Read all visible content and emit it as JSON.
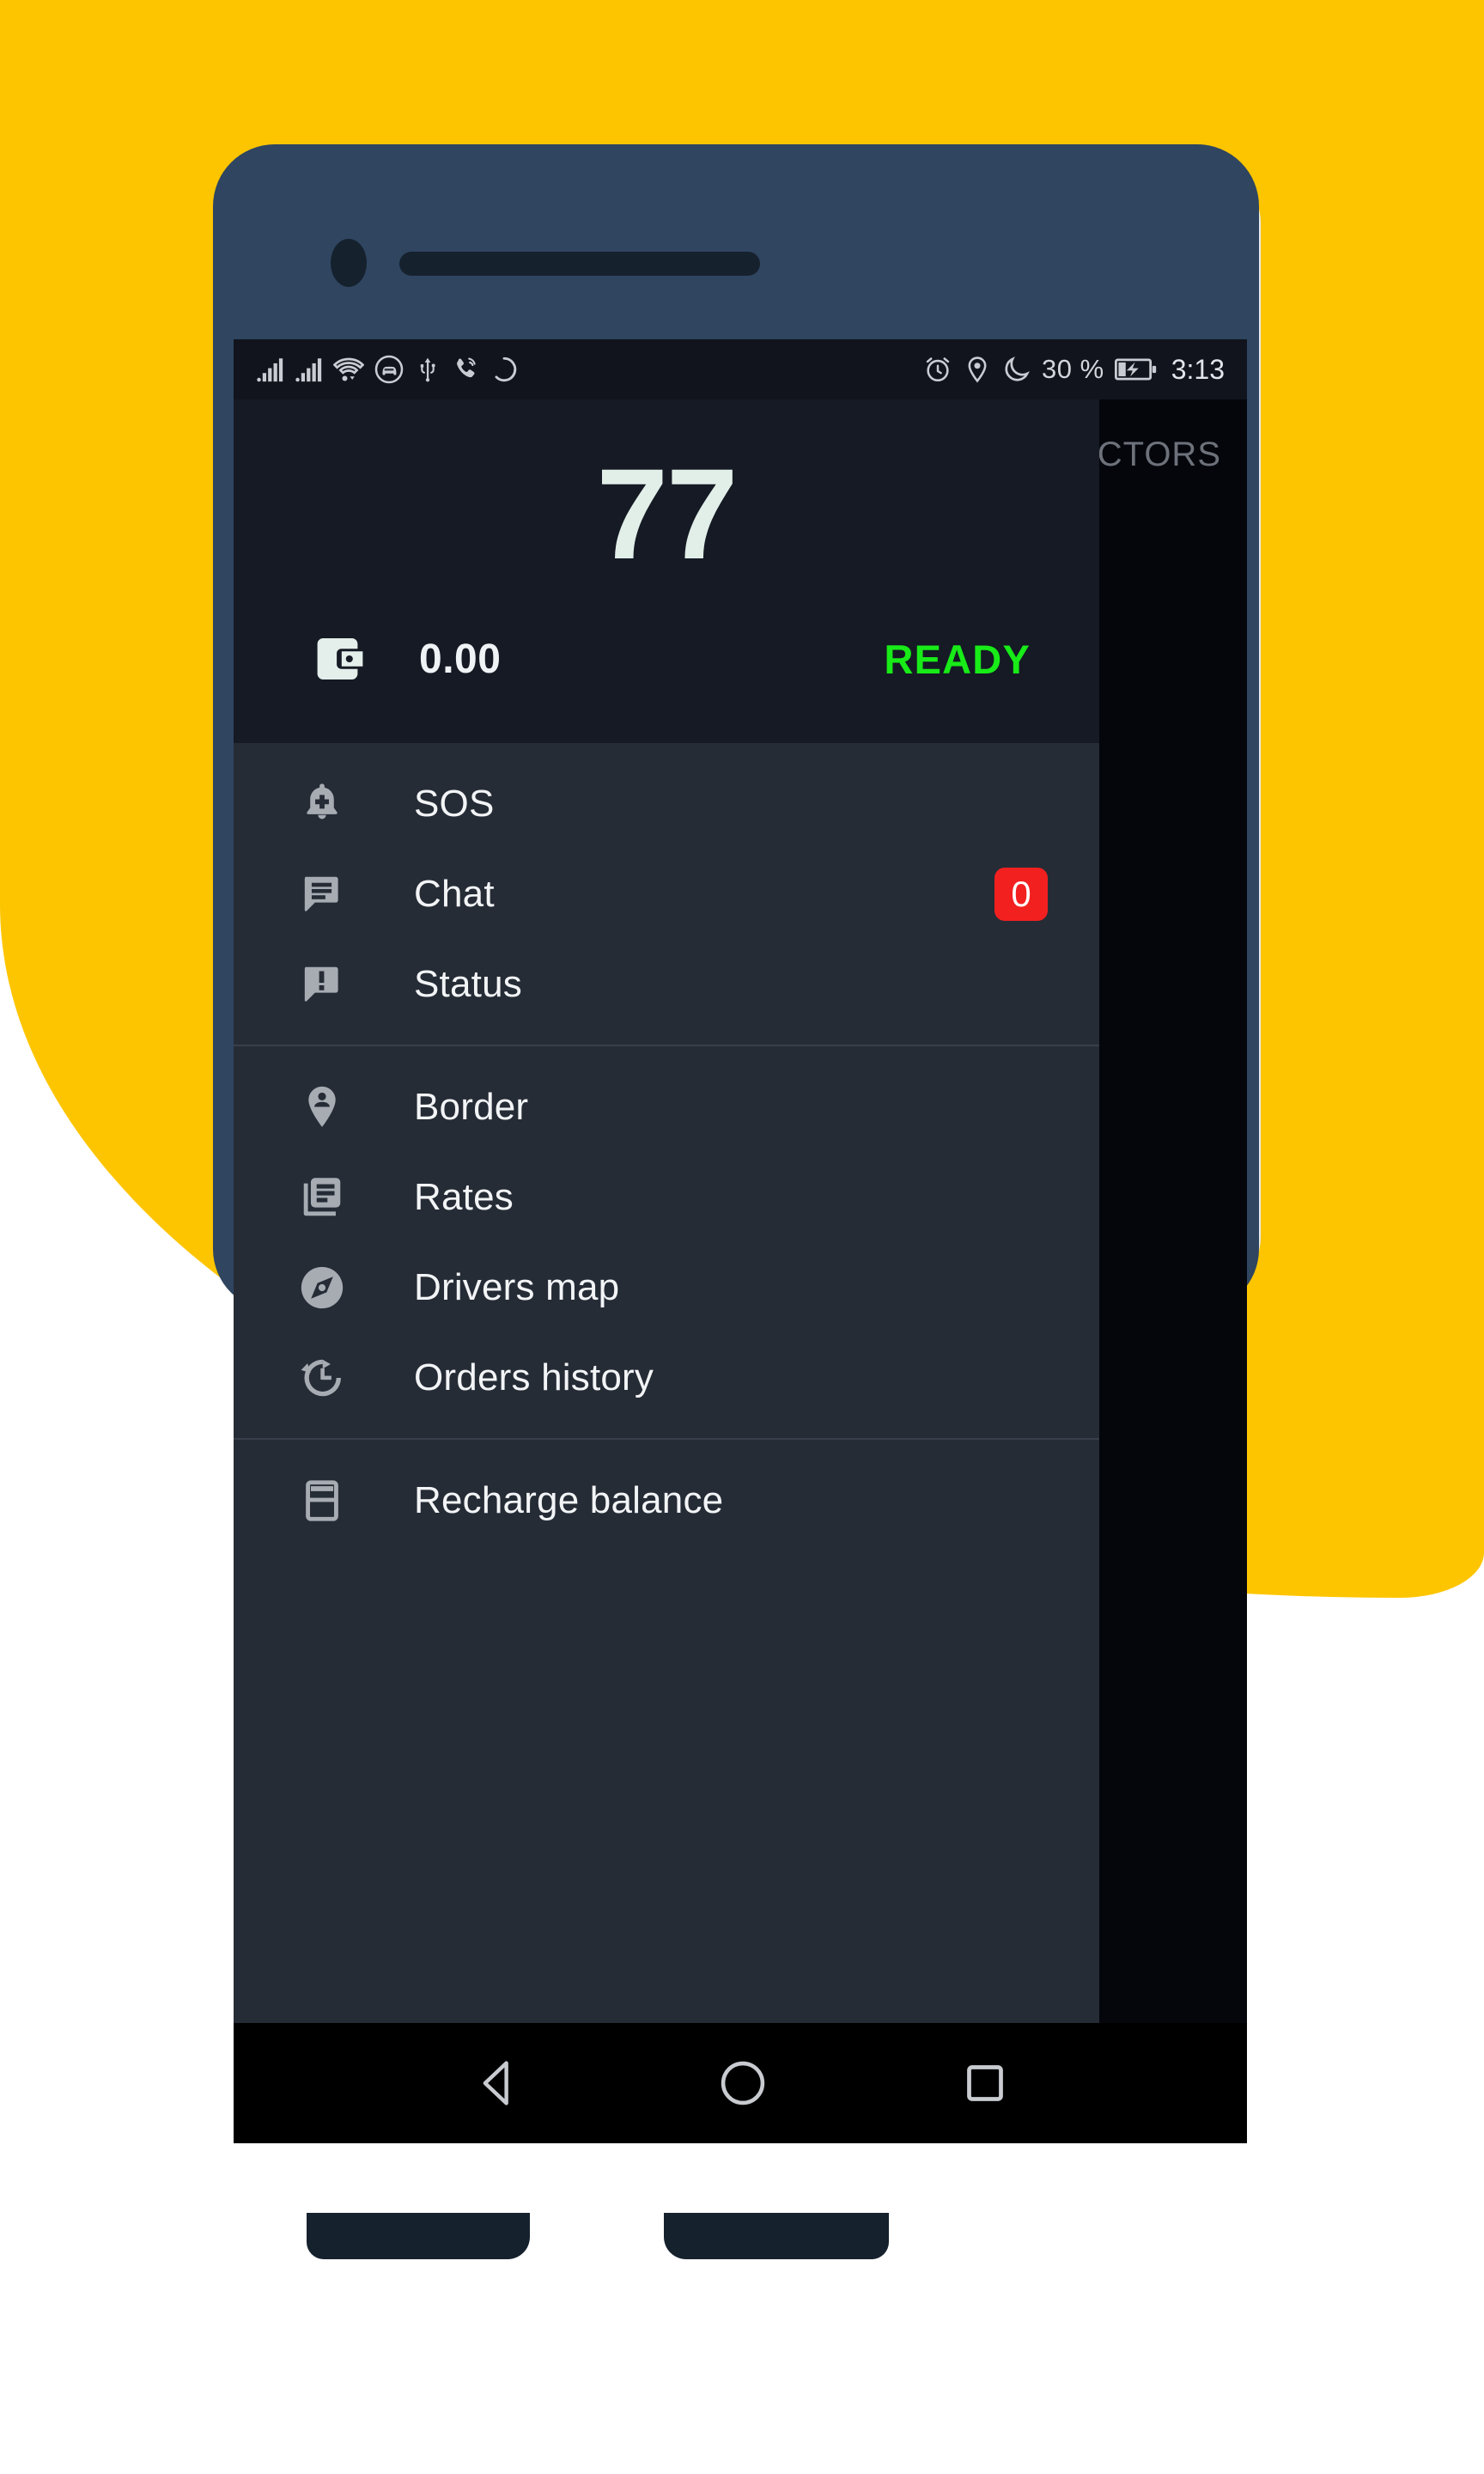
{
  "background": {
    "accent_color": "#FDC500",
    "page_color": "#FFFFFF"
  },
  "device": {
    "body_color": "#2F4560",
    "hardware_color": "#16212E",
    "camera_icon": "front-camera",
    "speaker_icon": "earpiece-speaker"
  },
  "status_bar": {
    "left_icons": [
      "signal-bars-sim1-icon",
      "signal-bars-sim2-icon",
      "wifi-icon",
      "car-mode-icon",
      "usb-icon",
      "call-forward-icon",
      "sync-icon"
    ],
    "right_icons": [
      "alarm-icon",
      "location-icon",
      "do-not-disturb-moon-icon",
      "battery-charging-icon"
    ],
    "battery_text": "30 %",
    "time": "3:13"
  },
  "app_behind": {
    "visible_title_fragment": "CTORS"
  },
  "drawer": {
    "header": {
      "counter": "77",
      "wallet_icon": "wallet-icon",
      "balance": "0.00",
      "status": "READY",
      "status_color": "#18EB18",
      "counter_color": "#E2EFE9"
    },
    "groups": [
      {
        "items": [
          {
            "icon": "add-alert-bell-icon",
            "label": "SOS",
            "badge": null
          },
          {
            "icon": "chat-bubble-icon",
            "label": "Chat",
            "badge": "0"
          },
          {
            "icon": "status-announcement-icon",
            "label": "Status",
            "badge": null
          }
        ]
      },
      {
        "items": [
          {
            "icon": "location-pin-person-icon",
            "label": "Border",
            "badge": null
          },
          {
            "icon": "rates-list-icon",
            "label": "Rates",
            "badge": null
          },
          {
            "icon": "compass-explore-icon",
            "label": "Drivers map",
            "badge": null
          },
          {
            "icon": "history-clock-icon",
            "label": "Orders history",
            "badge": null
          }
        ]
      },
      {
        "items": [
          {
            "icon": "credit-card-icon",
            "label": "Recharge balance",
            "badge": null
          }
        ]
      }
    ],
    "badge_color": "#F32020",
    "surface_color": "#262C36",
    "header_color": "#151A24"
  },
  "nav_bar": {
    "buttons": [
      {
        "icon": "android-back-icon",
        "label": "Back"
      },
      {
        "icon": "android-home-icon",
        "label": "Home"
      },
      {
        "icon": "android-recents-icon",
        "label": "Recents"
      }
    ]
  }
}
